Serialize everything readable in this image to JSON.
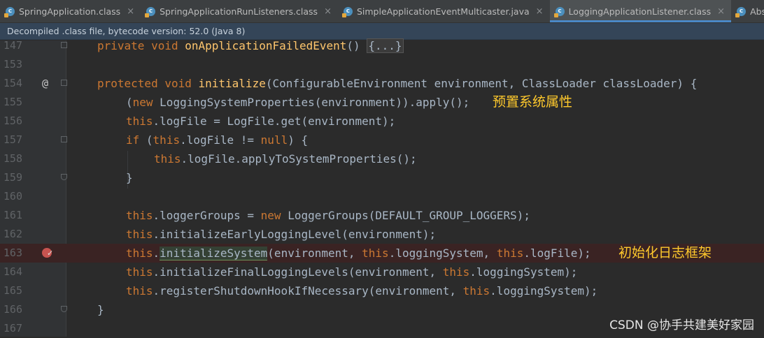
{
  "tabs": [
    {
      "label": "SpringApplication.class",
      "active": false
    },
    {
      "label": "SpringApplicationRunListeners.class",
      "active": false
    },
    {
      "label": "SimpleApplicationEventMulticaster.java",
      "active": false
    },
    {
      "label": "LoggingApplicationListener.class",
      "active": true
    },
    {
      "label": "AbstractLoggingSy",
      "active": false
    }
  ],
  "tab_icon_letter": "c",
  "tab_close_glyph": "×",
  "banner": "Decompiled .class file, bytecode version: 52.0 (Java 8)",
  "line_numbers": {
    "l147": "147",
    "l153": "153",
    "l154": "154",
    "l155": "155",
    "l156": "156",
    "l157": "157",
    "l158": "158",
    "l159": "159",
    "l160": "160",
    "l161": "161",
    "l162": "162",
    "l163": "163",
    "l164": "164",
    "l165": "165",
    "l166": "166",
    "l167": "167"
  },
  "gutter": {
    "annotation_symbol": "@"
  },
  "code": {
    "l147": {
      "kw": "private void ",
      "fn": "onApplicationFailedEvent",
      "rest": "() ",
      "fold": "{...}"
    },
    "l154": {
      "kw1": "protected void ",
      "fn": "initialize",
      "rest": "(ConfigurableEnvironment environment, ClassLoader classLoader) {"
    },
    "l155": {
      "p1": "(",
      "kw": "new ",
      "rest": "LoggingSystemProperties(environment)).apply();"
    },
    "l156": {
      "kw": "this",
      "rest": ".logFile = LogFile.get(environment);"
    },
    "l157": {
      "kw1": "if ",
      "p1": "(",
      "kw2": "this",
      "p2": ".logFile != ",
      "kw3": "null",
      "p3": ") {"
    },
    "l158": {
      "kw": "this",
      "rest": ".logFile.applyToSystemProperties();"
    },
    "l159": {
      "rest": "}"
    },
    "l161": {
      "kw1": "this",
      "p1": ".loggerGroups = ",
      "kw2": "new ",
      "p2": "LoggerGroups(DEFAULT_GROUP_LOGGERS);"
    },
    "l162": {
      "kw": "this",
      "rest": ".initializeEarlyLoggingLevel(environment);"
    },
    "l163": {
      "kw1": "this",
      "p1": ".",
      "sel": "initializeSystem",
      "p2": "(environment, ",
      "kw2": "this",
      "p3": ".loggingSystem, ",
      "kw3": "this",
      "p4": ".logFile);"
    },
    "l164": {
      "kw1": "this",
      "p1": ".initializeFinalLoggingLevels(environment, ",
      "kw2": "this",
      "p2": ".loggingSystem);"
    },
    "l165": {
      "kw1": "this",
      "p1": ".registerShutdownHookIfNecessary(environment, ",
      "kw2": "this",
      "p2": ".loggingSystem);"
    },
    "l166": {
      "rest": "}"
    }
  },
  "annotations": {
    "note1": "预置系统属性",
    "note2": "初始化日志框架"
  },
  "watermark": "CSDN @协手共建美好家园",
  "colors": {
    "background": "#2b2b2b",
    "keyword": "#cc7832",
    "method_declaration": "#ffc66d",
    "plain_text": "#a9b7c6",
    "annotation_note": "#ffc92c",
    "breakpoint": "#c75450",
    "active_tab_underline": "#4a88c7"
  },
  "icons": [
    "java-class-icon",
    "close-icon",
    "annotation-icon",
    "fold-icon",
    "breakpoint-icon"
  ]
}
